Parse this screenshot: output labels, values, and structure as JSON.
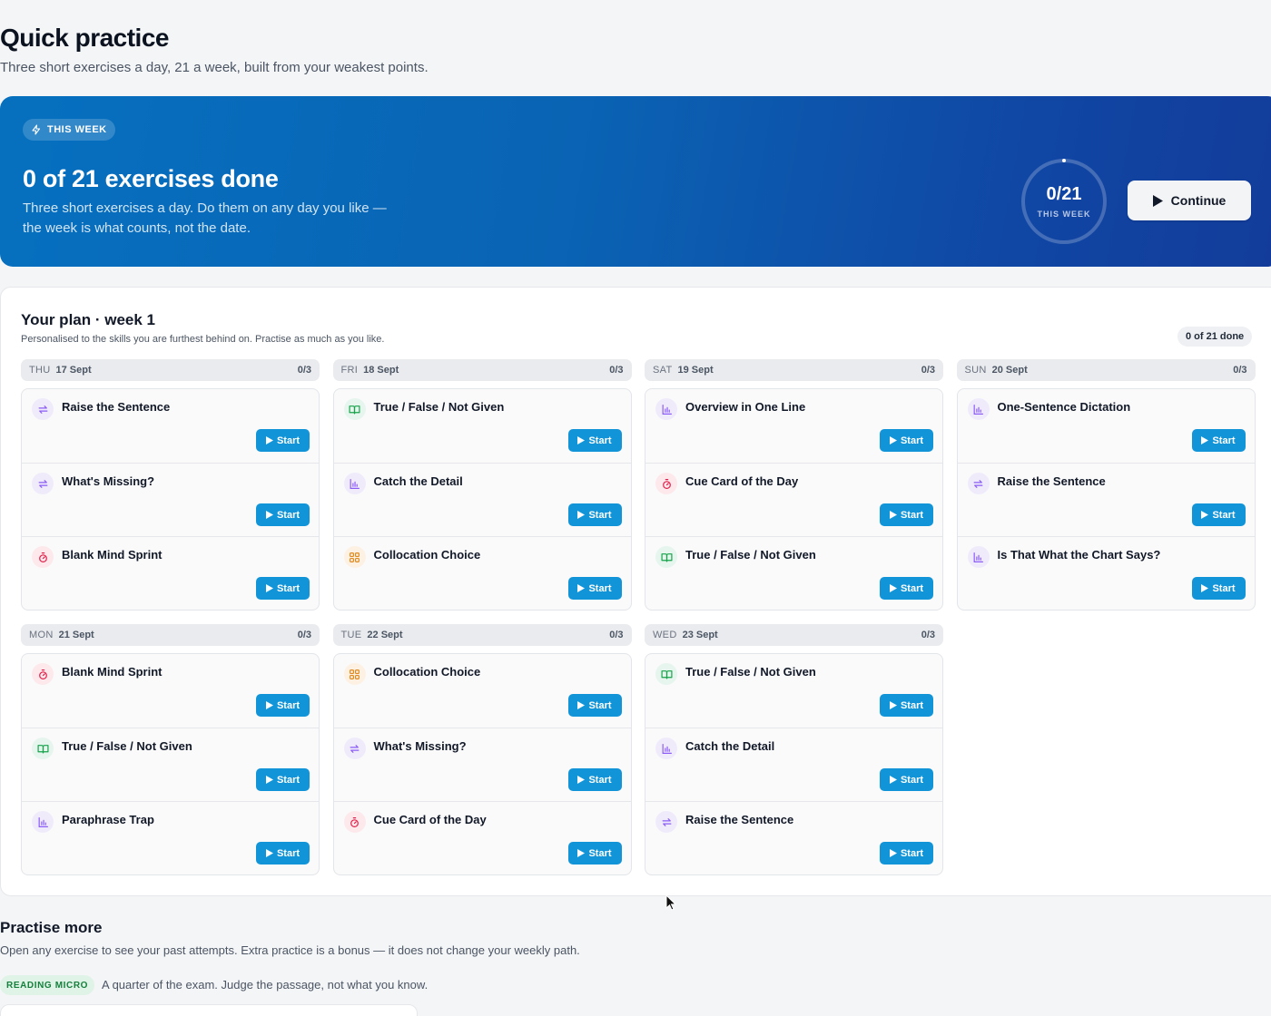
{
  "header": {
    "title": "Quick practice",
    "subtitle": "Three short exercises a day, 21 a week, built from your weakest points."
  },
  "hero": {
    "badge": "THIS WEEK",
    "title": "0 of 21 exercises done",
    "description": "Three short exercises a day. Do them on any day you like — the week is what counts, not the date.",
    "ring_count": "0/21",
    "ring_label": "THIS WEEK",
    "progress": 0,
    "continue_label": "Continue"
  },
  "plan": {
    "title": "Your plan · week 1",
    "subtitle": "Personalised to the skills you are furthest behind on. Practise as much as you like.",
    "done_badge": "0 of 21 done",
    "start_label": "Start",
    "days": [
      {
        "dow": "THU",
        "date": "17 Sept",
        "progress": "0/3",
        "exercises": [
          {
            "name": "Raise the Sentence",
            "icon": "swap-icon"
          },
          {
            "name": "What's Missing?",
            "icon": "swap-icon"
          },
          {
            "name": "Blank Mind Sprint",
            "icon": "timer-icon"
          }
        ]
      },
      {
        "dow": "FRI",
        "date": "18 Sept",
        "progress": "0/3",
        "exercises": [
          {
            "name": "True / False / Not Given",
            "icon": "book-icon"
          },
          {
            "name": "Catch the Detail",
            "icon": "chart-icon"
          },
          {
            "name": "Collocation Choice",
            "icon": "grid-icon"
          }
        ]
      },
      {
        "dow": "SAT",
        "date": "19 Sept",
        "progress": "0/3",
        "exercises": [
          {
            "name": "Overview in One Line",
            "icon": "chart-icon"
          },
          {
            "name": "Cue Card of the Day",
            "icon": "timer-icon"
          },
          {
            "name": "True / False / Not Given",
            "icon": "book-icon"
          }
        ]
      },
      {
        "dow": "SUN",
        "date": "20 Sept",
        "progress": "0/3",
        "exercises": [
          {
            "name": "One-Sentence Dictation",
            "icon": "chart-icon"
          },
          {
            "name": "Raise the Sentence",
            "icon": "swap-icon"
          },
          {
            "name": "Is That What the Chart Says?",
            "icon": "chart-icon"
          }
        ]
      },
      {
        "dow": "MON",
        "date": "21 Sept",
        "progress": "0/3",
        "exercises": [
          {
            "name": "Blank Mind Sprint",
            "icon": "timer-icon"
          },
          {
            "name": "True / False / Not Given",
            "icon": "book-icon"
          },
          {
            "name": "Paraphrase Trap",
            "icon": "chart-icon"
          }
        ]
      },
      {
        "dow": "TUE",
        "date": "22 Sept",
        "progress": "0/3",
        "exercises": [
          {
            "name": "Collocation Choice",
            "icon": "grid-icon"
          },
          {
            "name": "What's Missing?",
            "icon": "swap-icon"
          },
          {
            "name": "Cue Card of the Day",
            "icon": "timer-icon"
          }
        ]
      },
      {
        "dow": "WED",
        "date": "23 Sept",
        "progress": "0/3",
        "exercises": [
          {
            "name": "True / False / Not Given",
            "icon": "book-icon"
          },
          {
            "name": "Catch the Detail",
            "icon": "chart-icon"
          },
          {
            "name": "Raise the Sentence",
            "icon": "swap-icon"
          }
        ]
      }
    ]
  },
  "practise_more": {
    "title": "Practise more",
    "subtitle": "Open any exercise to see your past attempts. Extra practice is a bonus — it does not change your weekly path.",
    "tag": "READING MICRO",
    "tag_desc": "A quarter of the exam. Judge the passage, not what you know."
  },
  "colors": {
    "accent": "#1294d8",
    "hero_start": "#0670bf",
    "hero_end": "#133c9a",
    "icon_purple": "#8b5cf6",
    "icon_green": "#16a34a",
    "icon_red": "#e11d48",
    "icon_orange": "#e08a1e"
  }
}
